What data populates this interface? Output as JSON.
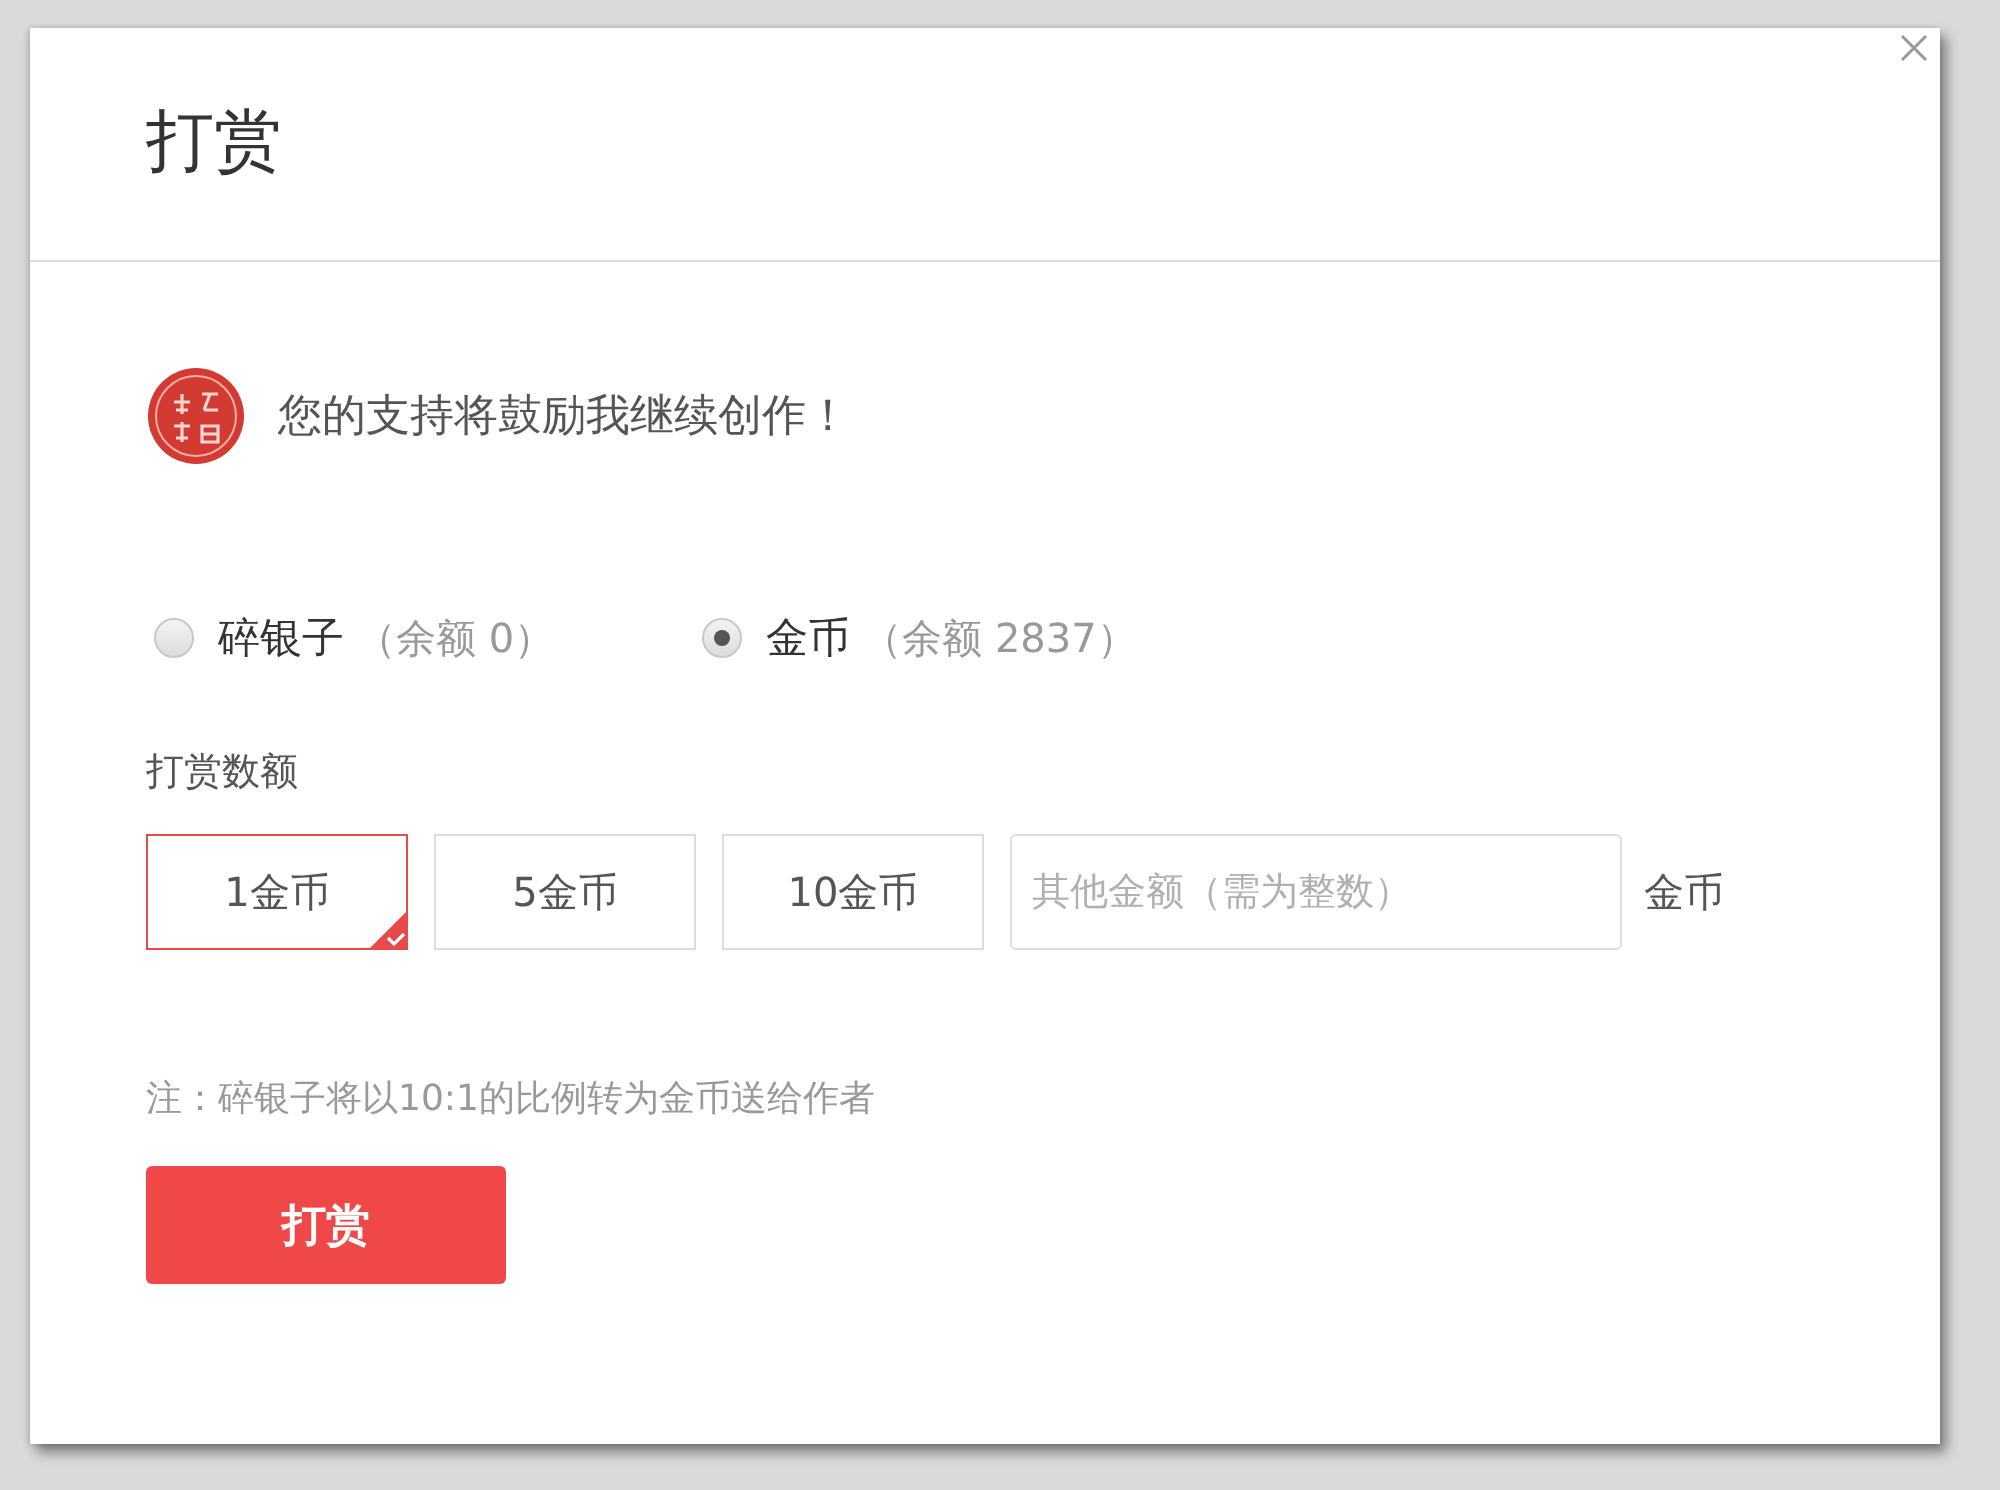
{
  "dialog": {
    "title": "打赏"
  },
  "message": "您的支持将鼓励我继续创作！",
  "currencies": [
    {
      "name": "碎银子",
      "balance": "（余额 0）",
      "selected": false
    },
    {
      "name": "金币",
      "balance": "（余额 2837）",
      "selected": true
    }
  ],
  "amount_label": "打赏数额",
  "amount_options": [
    {
      "label": "1金币",
      "selected": true
    },
    {
      "label": "5金币",
      "selected": false
    },
    {
      "label": "10金币",
      "selected": false
    }
  ],
  "custom_amount": {
    "placeholder": "其他金额（需为整数）",
    "unit": "金币"
  },
  "note": "注：碎银子将以10:1的比例转为金币送给作者",
  "submit_button": "打赏"
}
